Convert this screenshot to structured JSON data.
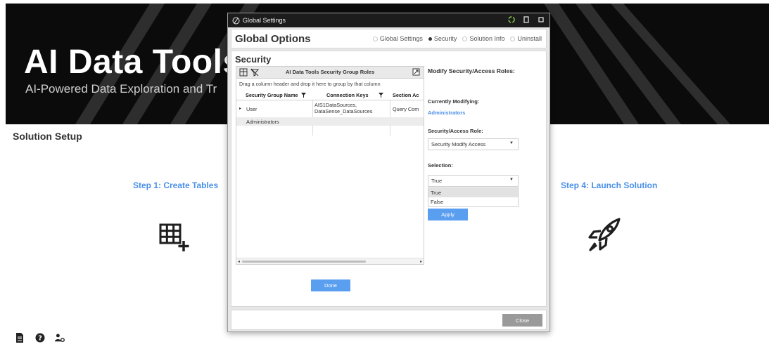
{
  "hero": {
    "title": "AI Data Tools",
    "subtitle": "AI-Powered Data Exploration and Tr"
  },
  "page": {
    "section_title": "Solution Setup",
    "steps": [
      {
        "label": "Step 1: Create Tables",
        "icon": "table-add-icon"
      },
      {
        "label": "Step 4: Launch Solution",
        "icon": "rocket-icon"
      }
    ],
    "footer_icons": [
      "document-icon",
      "help-icon",
      "user-settings-icon"
    ]
  },
  "dialog": {
    "window_title": "Global Settings",
    "header_title": "Global Options",
    "nav": [
      {
        "label": "Global Settings",
        "selected": false
      },
      {
        "label": "Security",
        "selected": true
      },
      {
        "label": "Solution Info",
        "selected": false
      },
      {
        "label": "Uninstall",
        "selected": false
      }
    ],
    "section_title": "Security",
    "grid": {
      "caption": "AI Data Tools Security Group Roles",
      "group_hint": "Drag a column header and drop it here to group by that column",
      "columns": [
        "Security Group Name",
        "Connection Keys",
        "Section Ac"
      ],
      "rows": [
        {
          "name": "User",
          "keys": "AIS1DataSources, DataSense_DataSources",
          "section": "Query Com"
        },
        {
          "name": "Administrators",
          "keys": "",
          "section": ""
        }
      ]
    },
    "done_label": "Done",
    "panel": {
      "title": "Modify Security/Access Roles:",
      "currently_label": "Currently Modifying:",
      "currently_value": "Administrators",
      "role_label": "Security/Access Role:",
      "role_value": "Security Modify Access",
      "selection_label": "Selection:",
      "selection_value": "True",
      "options": [
        "True",
        "False"
      ],
      "apply_label": "Apply"
    },
    "close_label": "Close"
  },
  "colors": {
    "accent": "#4a8fe8",
    "button": "#5a9ef0",
    "hero_bg": "#0b0b0b",
    "close_button": "#9a9a9a"
  }
}
